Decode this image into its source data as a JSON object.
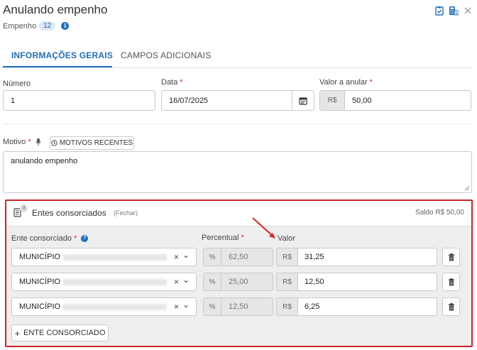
{
  "header": {
    "title": "Anulando empenho",
    "subtitle_label": "Empenho",
    "subtitle_count": "12",
    "info_glyph": "i"
  },
  "tabs": [
    {
      "label": "INFORMAÇÕES GERAIS",
      "active": true
    },
    {
      "label": "CAMPOS ADICIONAIS",
      "active": false
    }
  ],
  "form": {
    "numero": {
      "label": "Número",
      "value": "1"
    },
    "data": {
      "label": "Data",
      "required_mark": "*",
      "value": "16/07/2025"
    },
    "valor_anular": {
      "label": "Valor a anular",
      "required_mark": "*",
      "prefix": "R$",
      "value": "50,00"
    },
    "motivo": {
      "label": "Motivo",
      "required_mark": "*",
      "recent_button": "MOTIVOS RECENTES",
      "value": "anulando empenho"
    }
  },
  "consorciados": {
    "title": "Entes consorciados",
    "close_link": "(Fechar)",
    "badge_count": "3",
    "saldo": "Saldo R$ 50,00",
    "col_ente": "Ente consorciado",
    "col_percentual": "Percentual",
    "col_valor": "Valor",
    "required_mark": "*",
    "help_glyph": "?",
    "percent_prefix": "%",
    "currency_prefix": "R$",
    "rows": [
      {
        "ente": "MUNICÍPIO",
        "percentual": "62,50",
        "valor": "31,25"
      },
      {
        "ente": "MUNICÍPIO",
        "percentual": "25,00",
        "valor": "12,50"
      },
      {
        "ente": "MUNICÍPIO",
        "percentual": "12,50",
        "valor": "6,25"
      }
    ],
    "add_button": "ENTE CONSORCIADO",
    "clear_glyph": "×",
    "chevron_glyph": "⌄",
    "add_glyph": "+"
  },
  "colors": {
    "accent": "#1f6fb8",
    "required": "#d0302e",
    "highlight_border": "#d4202a"
  }
}
